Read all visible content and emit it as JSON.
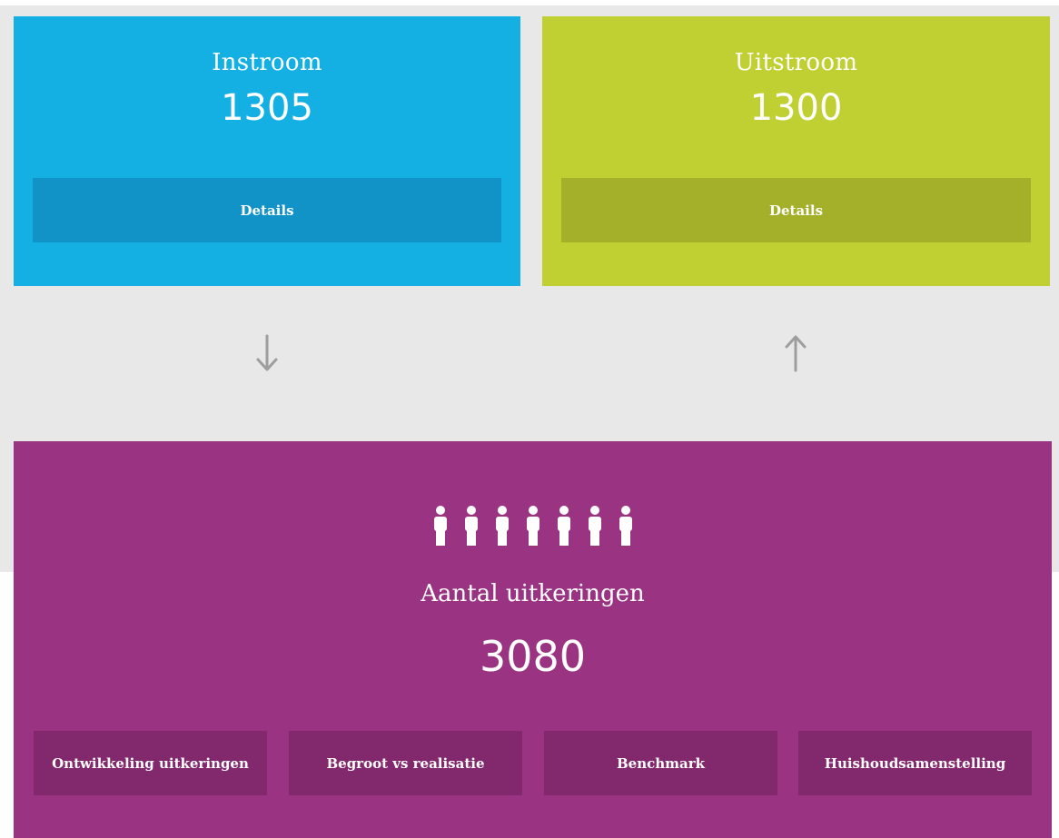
{
  "instroom": {
    "title": "Instroom",
    "value": "1305",
    "details_label": "Details",
    "color": "#14b0e4",
    "button_color": "#1193c7"
  },
  "uitstroom": {
    "title": "Uitstroom",
    "value": "1300",
    "details_label": "Details",
    "color": "#c0d032",
    "button_color": "#a4b02a"
  },
  "flow": {
    "down_icon": "arrow-down-icon",
    "up_icon": "arrow-up-icon",
    "arrow_color": "#9e9e9e"
  },
  "uitkeringen": {
    "icon": "people-icon",
    "title": "Aantal uitkeringen",
    "value": "3080",
    "color": "#993382",
    "button_color": "#82286d",
    "buttons": [
      "Ontwikkeling uitkeringen",
      "Begroot vs realisatie",
      "Benchmark",
      "Huishoudsamenstelling"
    ]
  }
}
